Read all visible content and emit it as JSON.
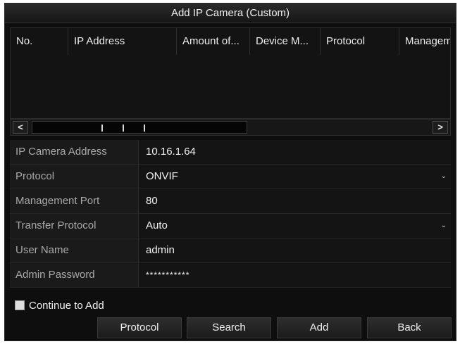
{
  "dialog": {
    "title": "Add IP Camera (Custom)"
  },
  "table": {
    "columns": [
      "No.",
      "IP Address",
      "Amount of...",
      "Device M...",
      "Protocol",
      "Managem"
    ]
  },
  "form": {
    "ip_address": {
      "label": "IP Camera Address",
      "value": "10.16.1.64"
    },
    "protocol": {
      "label": "Protocol",
      "value": "ONVIF"
    },
    "management_port": {
      "label": "Management Port",
      "value": "80"
    },
    "transfer_protocol": {
      "label": "Transfer Protocol",
      "value": "Auto"
    },
    "user_name": {
      "label": "User Name",
      "value": "admin"
    },
    "admin_password": {
      "label": "Admin Password",
      "value": "***********"
    }
  },
  "continue_to_add": {
    "label": "Continue to Add",
    "checked": false
  },
  "buttons": {
    "protocol": "Protocol",
    "search": "Search",
    "add": "Add",
    "back": "Back"
  },
  "icons": {
    "scroll_left": "<",
    "scroll_right": ">",
    "dropdown": "⌄"
  }
}
